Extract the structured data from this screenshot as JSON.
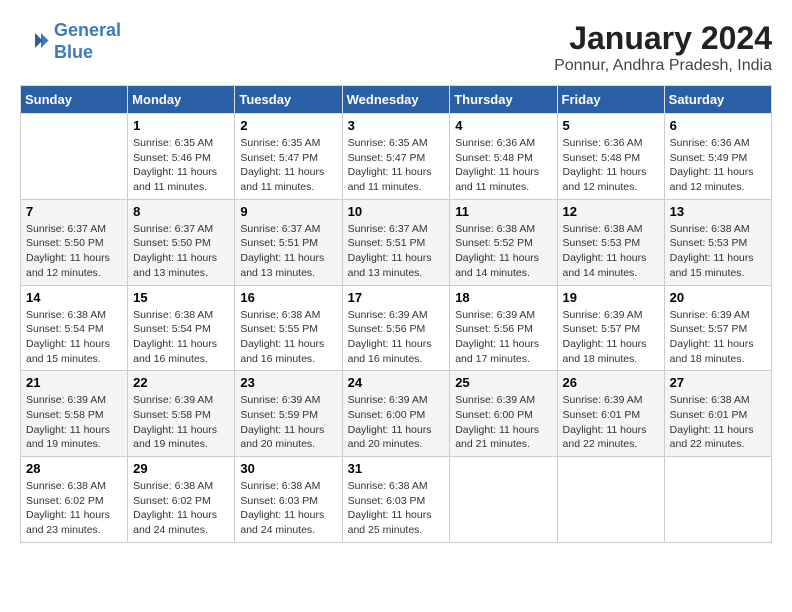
{
  "header": {
    "logo_line1": "General",
    "logo_line2": "Blue",
    "month_title": "January 2024",
    "location": "Ponnur, Andhra Pradesh, India"
  },
  "columns": [
    "Sunday",
    "Monday",
    "Tuesday",
    "Wednesday",
    "Thursday",
    "Friday",
    "Saturday"
  ],
  "weeks": [
    [
      {
        "day": "",
        "sunrise": "",
        "sunset": "",
        "daylight": ""
      },
      {
        "day": "1",
        "sunrise": "Sunrise: 6:35 AM",
        "sunset": "Sunset: 5:46 PM",
        "daylight": "Daylight: 11 hours and 11 minutes."
      },
      {
        "day": "2",
        "sunrise": "Sunrise: 6:35 AM",
        "sunset": "Sunset: 5:47 PM",
        "daylight": "Daylight: 11 hours and 11 minutes."
      },
      {
        "day": "3",
        "sunrise": "Sunrise: 6:35 AM",
        "sunset": "Sunset: 5:47 PM",
        "daylight": "Daylight: 11 hours and 11 minutes."
      },
      {
        "day": "4",
        "sunrise": "Sunrise: 6:36 AM",
        "sunset": "Sunset: 5:48 PM",
        "daylight": "Daylight: 11 hours and 11 minutes."
      },
      {
        "day": "5",
        "sunrise": "Sunrise: 6:36 AM",
        "sunset": "Sunset: 5:48 PM",
        "daylight": "Daylight: 11 hours and 12 minutes."
      },
      {
        "day": "6",
        "sunrise": "Sunrise: 6:36 AM",
        "sunset": "Sunset: 5:49 PM",
        "daylight": "Daylight: 11 hours and 12 minutes."
      }
    ],
    [
      {
        "day": "7",
        "sunrise": "Sunrise: 6:37 AM",
        "sunset": "Sunset: 5:50 PM",
        "daylight": "Daylight: 11 hours and 12 minutes."
      },
      {
        "day": "8",
        "sunrise": "Sunrise: 6:37 AM",
        "sunset": "Sunset: 5:50 PM",
        "daylight": "Daylight: 11 hours and 13 minutes."
      },
      {
        "day": "9",
        "sunrise": "Sunrise: 6:37 AM",
        "sunset": "Sunset: 5:51 PM",
        "daylight": "Daylight: 11 hours and 13 minutes."
      },
      {
        "day": "10",
        "sunrise": "Sunrise: 6:37 AM",
        "sunset": "Sunset: 5:51 PM",
        "daylight": "Daylight: 11 hours and 13 minutes."
      },
      {
        "day": "11",
        "sunrise": "Sunrise: 6:38 AM",
        "sunset": "Sunset: 5:52 PM",
        "daylight": "Daylight: 11 hours and 14 minutes."
      },
      {
        "day": "12",
        "sunrise": "Sunrise: 6:38 AM",
        "sunset": "Sunset: 5:53 PM",
        "daylight": "Daylight: 11 hours and 14 minutes."
      },
      {
        "day": "13",
        "sunrise": "Sunrise: 6:38 AM",
        "sunset": "Sunset: 5:53 PM",
        "daylight": "Daylight: 11 hours and 15 minutes."
      }
    ],
    [
      {
        "day": "14",
        "sunrise": "Sunrise: 6:38 AM",
        "sunset": "Sunset: 5:54 PM",
        "daylight": "Daylight: 11 hours and 15 minutes."
      },
      {
        "day": "15",
        "sunrise": "Sunrise: 6:38 AM",
        "sunset": "Sunset: 5:54 PM",
        "daylight": "Daylight: 11 hours and 16 minutes."
      },
      {
        "day": "16",
        "sunrise": "Sunrise: 6:38 AM",
        "sunset": "Sunset: 5:55 PM",
        "daylight": "Daylight: 11 hours and 16 minutes."
      },
      {
        "day": "17",
        "sunrise": "Sunrise: 6:39 AM",
        "sunset": "Sunset: 5:56 PM",
        "daylight": "Daylight: 11 hours and 16 minutes."
      },
      {
        "day": "18",
        "sunrise": "Sunrise: 6:39 AM",
        "sunset": "Sunset: 5:56 PM",
        "daylight": "Daylight: 11 hours and 17 minutes."
      },
      {
        "day": "19",
        "sunrise": "Sunrise: 6:39 AM",
        "sunset": "Sunset: 5:57 PM",
        "daylight": "Daylight: 11 hours and 18 minutes."
      },
      {
        "day": "20",
        "sunrise": "Sunrise: 6:39 AM",
        "sunset": "Sunset: 5:57 PM",
        "daylight": "Daylight: 11 hours and 18 minutes."
      }
    ],
    [
      {
        "day": "21",
        "sunrise": "Sunrise: 6:39 AM",
        "sunset": "Sunset: 5:58 PM",
        "daylight": "Daylight: 11 hours and 19 minutes."
      },
      {
        "day": "22",
        "sunrise": "Sunrise: 6:39 AM",
        "sunset": "Sunset: 5:58 PM",
        "daylight": "Daylight: 11 hours and 19 minutes."
      },
      {
        "day": "23",
        "sunrise": "Sunrise: 6:39 AM",
        "sunset": "Sunset: 5:59 PM",
        "daylight": "Daylight: 11 hours and 20 minutes."
      },
      {
        "day": "24",
        "sunrise": "Sunrise: 6:39 AM",
        "sunset": "Sunset: 6:00 PM",
        "daylight": "Daylight: 11 hours and 20 minutes."
      },
      {
        "day": "25",
        "sunrise": "Sunrise: 6:39 AM",
        "sunset": "Sunset: 6:00 PM",
        "daylight": "Daylight: 11 hours and 21 minutes."
      },
      {
        "day": "26",
        "sunrise": "Sunrise: 6:39 AM",
        "sunset": "Sunset: 6:01 PM",
        "daylight": "Daylight: 11 hours and 22 minutes."
      },
      {
        "day": "27",
        "sunrise": "Sunrise: 6:38 AM",
        "sunset": "Sunset: 6:01 PM",
        "daylight": "Daylight: 11 hours and 22 minutes."
      }
    ],
    [
      {
        "day": "28",
        "sunrise": "Sunrise: 6:38 AM",
        "sunset": "Sunset: 6:02 PM",
        "daylight": "Daylight: 11 hours and 23 minutes."
      },
      {
        "day": "29",
        "sunrise": "Sunrise: 6:38 AM",
        "sunset": "Sunset: 6:02 PM",
        "daylight": "Daylight: 11 hours and 24 minutes."
      },
      {
        "day": "30",
        "sunrise": "Sunrise: 6:38 AM",
        "sunset": "Sunset: 6:03 PM",
        "daylight": "Daylight: 11 hours and 24 minutes."
      },
      {
        "day": "31",
        "sunrise": "Sunrise: 6:38 AM",
        "sunset": "Sunset: 6:03 PM",
        "daylight": "Daylight: 11 hours and 25 minutes."
      },
      {
        "day": "",
        "sunrise": "",
        "sunset": "",
        "daylight": ""
      },
      {
        "day": "",
        "sunrise": "",
        "sunset": "",
        "daylight": ""
      },
      {
        "day": "",
        "sunrise": "",
        "sunset": "",
        "daylight": ""
      }
    ]
  ]
}
